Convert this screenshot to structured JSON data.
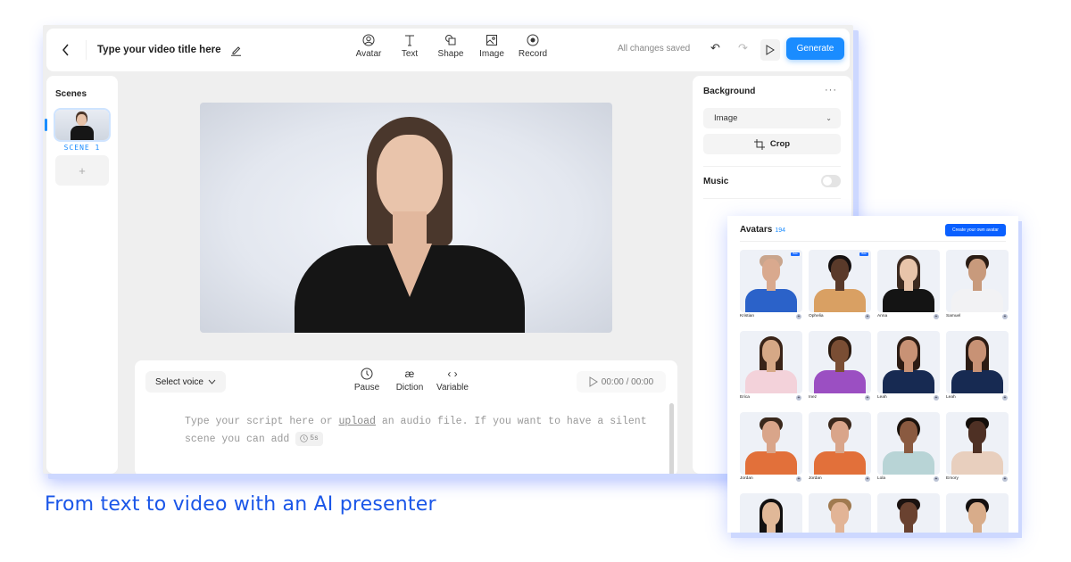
{
  "editor": {
    "title": "Type your video title here",
    "tools": [
      {
        "label": "Avatar",
        "icon": "avatar-icon"
      },
      {
        "label": "Text",
        "icon": "text-icon"
      },
      {
        "label": "Shape",
        "icon": "shape-icon"
      },
      {
        "label": "Image",
        "icon": "image-icon"
      },
      {
        "label": "Record",
        "icon": "record-icon"
      }
    ],
    "save_status": "All changes saved",
    "generate_label": "Generate"
  },
  "scenes": {
    "title": "Scenes",
    "items": [
      {
        "label": "SCENE 1"
      }
    ],
    "add_label": "+"
  },
  "properties": {
    "background_title": "Background",
    "background_type": "Image",
    "crop_label": "Crop",
    "music_title": "Music",
    "music_enabled": false
  },
  "script": {
    "voice_label": "Select voice",
    "tools": [
      {
        "label": "Pause",
        "icon": "clock-icon",
        "glyph": "◷"
      },
      {
        "label": "Diction",
        "icon": "diction-icon",
        "glyph": "æ"
      },
      {
        "label": "Variable",
        "icon": "code-icon",
        "glyph": "‹ ›"
      }
    ],
    "time": "00:00 / 00:00",
    "placeholder_part1": "Type your script here or ",
    "placeholder_link": "upload",
    "placeholder_part2": " an audio file. If you want to have a silent scene you can add ",
    "pause_chip": "5s"
  },
  "caption": "From text to video with an AI presenter",
  "library": {
    "title": "Avatars",
    "count": "194",
    "create_label": "Create your own avatar",
    "avatars": [
      {
        "name": "Kristian",
        "badge": "Beta"
      },
      {
        "name": "Ophelia",
        "badge": "Beta"
      },
      {
        "name": "Anna"
      },
      {
        "name": "Samuel"
      },
      {
        "name": "Erica"
      },
      {
        "name": "Inez"
      },
      {
        "name": "Leah"
      },
      {
        "name": "Leah"
      },
      {
        "name": "Jordan"
      },
      {
        "name": "Jordan"
      },
      {
        "name": "Lola"
      },
      {
        "name": "Emory"
      },
      {
        "name": ""
      },
      {
        "name": ""
      },
      {
        "name": ""
      },
      {
        "name": ""
      }
    ]
  },
  "colors": {
    "accent": "#1a8cff",
    "caption": "#1a56e8",
    "library_button": "#0a60ff"
  }
}
